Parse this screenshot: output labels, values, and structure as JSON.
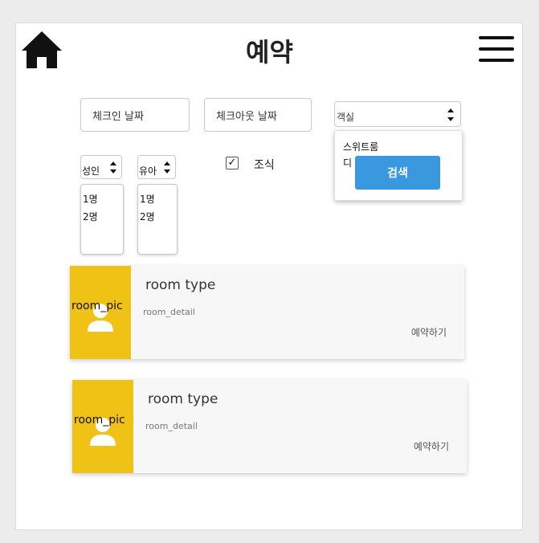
{
  "header": {
    "title": "예약",
    "home_icon": "home-icon",
    "menu_icon": "hamburger-menu-icon"
  },
  "form": {
    "checkin_placeholder": "체크인 날짜",
    "checkout_placeholder": "체크아웃 날짜",
    "room_select": {
      "selected": "객실",
      "options": [
        "스위트룸",
        "디"
      ]
    },
    "search_label": "검색",
    "adults_select": {
      "selected": "성인",
      "options": [
        "1명",
        "2명"
      ]
    },
    "kids_select": {
      "selected": "유아",
      "options": [
        "1명",
        "2명"
      ]
    },
    "breakfast": {
      "label": "조식",
      "checked": true,
      "check_mark": "✓"
    }
  },
  "rooms": [
    {
      "pic_label": "room_pic",
      "type": "room type",
      "detail": "room_detail",
      "reserve_label": "예약하기"
    },
    {
      "pic_label": "room_pic",
      "type": "room type",
      "detail": "room_detail",
      "reserve_label": "예약하기"
    }
  ],
  "colors": {
    "accent": "#f0c216",
    "button": "#3a98de"
  }
}
